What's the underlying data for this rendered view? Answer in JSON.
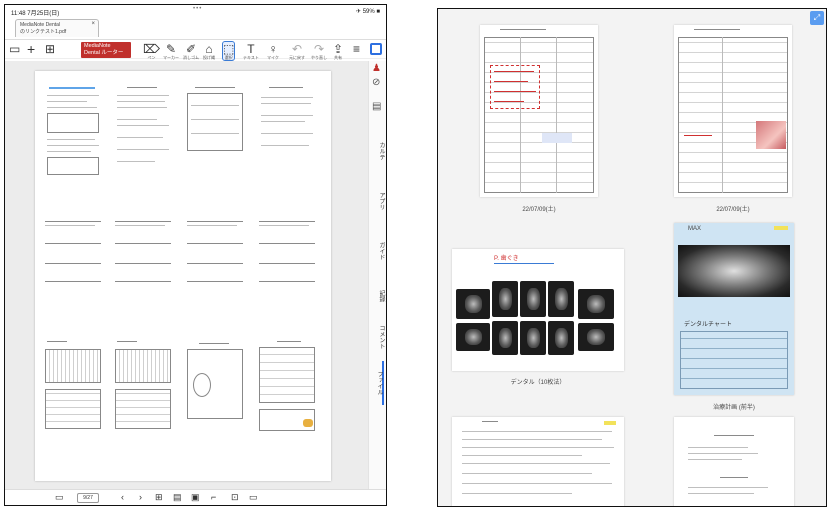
{
  "left_panel": {
    "status": {
      "time": "11:48 7月25日(日)",
      "dots": "•••",
      "battery": "✈ 59% ■"
    },
    "doc_tab": {
      "line1": "MediaNote Dental",
      "line2": "のリンクテスト1.pdf"
    },
    "toolbar": {
      "red_tag": "MediaNote Dental ルーター",
      "labels": [
        "ペン",
        "マーカー",
        "消しゴム",
        "投げ縄",
        "選択",
        "テキスト",
        "マイク",
        "元に戻す",
        "やり直し",
        "共有"
      ]
    },
    "sidebar_tabs": [
      "カルテ",
      "アプリ",
      "ガイド",
      "記録",
      "コメント",
      "ファイル"
    ],
    "bottom": {
      "page_label": "9/27"
    }
  },
  "right_panel": {
    "captions": [
      "22/07/09(土)",
      "22/07/09(土)",
      "デンタル（10枚法）",
      "治療計画 (前半)"
    ],
    "handwriting": {
      "dental_title": "P. 歯ぐき",
      "pano_title": "MAX",
      "plan_title": "デンタルチャート"
    }
  },
  "colors": {
    "accent": "#2d6fe0",
    "red_tag": "#c0302c",
    "plan_bg": "#cfe4f3",
    "handwriting": "#d03030"
  }
}
